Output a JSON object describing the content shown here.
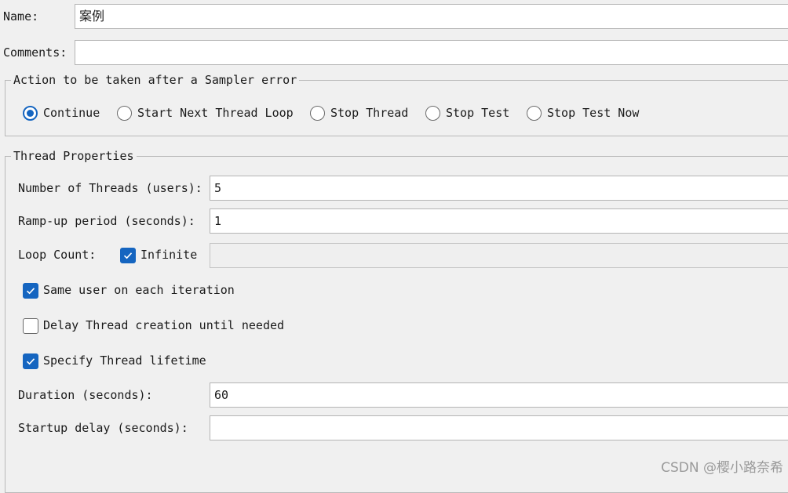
{
  "name": {
    "label": "Name:",
    "value": "案例"
  },
  "comments": {
    "label": "Comments:",
    "value": ""
  },
  "sampler_error": {
    "title": "Action to be taken after a Sampler error",
    "options": [
      {
        "label": "Continue",
        "selected": true
      },
      {
        "label": "Start Next Thread Loop",
        "selected": false
      },
      {
        "label": "Stop Thread",
        "selected": false
      },
      {
        "label": "Stop Test",
        "selected": false
      },
      {
        "label": "Stop Test Now",
        "selected": false
      }
    ]
  },
  "thread_properties": {
    "title": "Thread Properties",
    "num_threads": {
      "label": "Number of Threads (users):",
      "value": "5"
    },
    "ramp_up": {
      "label": "Ramp-up period (seconds):",
      "value": "1"
    },
    "loop_count": {
      "label": "Loop Count:",
      "infinite_label": "Infinite",
      "infinite_checked": true,
      "value": ""
    },
    "same_user": {
      "label": "Same user on each iteration",
      "checked": true
    },
    "delay_thread": {
      "label": "Delay Thread creation until needed",
      "checked": false
    },
    "specify_lifetime": {
      "label": "Specify Thread lifetime",
      "checked": true
    },
    "duration": {
      "label": "Duration (seconds):",
      "value": "60"
    },
    "startup_delay": {
      "label": "Startup delay (seconds):",
      "value": ""
    }
  },
  "colors": {
    "accent": "#1565c0",
    "background": "#f0f0f0",
    "field_border": "#b4b4b4"
  },
  "watermark": "CSDN @樱小路奈希"
}
